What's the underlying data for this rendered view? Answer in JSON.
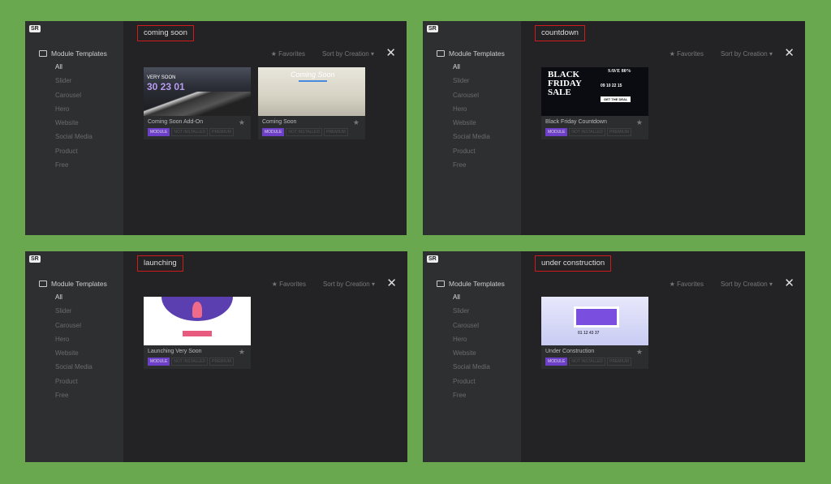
{
  "panels": [
    {
      "search": "coming soon",
      "cards": [
        {
          "title": "Coming Soon Add-On",
          "thumb": "mountain",
          "thumb_text": [
            "VERY SOON",
            "30 23 01"
          ]
        },
        {
          "title": "Coming Soon",
          "thumb": "horse",
          "thumb_text": [
            "Coming Soon"
          ]
        }
      ]
    },
    {
      "search": "countdown",
      "cards": [
        {
          "title": "Black Friday Countdown",
          "thumb": "blackfriday",
          "thumb_text": [
            "BLACK FRIDAY SALE",
            "SAVE 80%",
            "09 10 22 15",
            "GET THE DEAL"
          ]
        }
      ]
    },
    {
      "search": "launching",
      "cards": [
        {
          "title": "Launching Very Soon",
          "thumb": "rocket",
          "thumb_text": []
        }
      ]
    },
    {
      "search": "under construction",
      "cards": [
        {
          "title": "Under Construction",
          "thumb": "construction",
          "thumb_text": [
            "01 12 43 37"
          ]
        }
      ]
    }
  ],
  "common": {
    "logo": "SR",
    "section_title": "Module Templates",
    "categories": [
      "All",
      "Slider",
      "Carousel",
      "Hero",
      "Website",
      "Social Media",
      "Product",
      "Free"
    ],
    "favorites": "Favorites",
    "sort": "Sort by Creation",
    "close": "✕",
    "tags": [
      "MODULE",
      "NOT INSTALLED",
      "PREMIUM"
    ]
  },
  "colors": {
    "accent": "#6e3fc9",
    "highlight_box": "#d0191a",
    "background": "#6aa84f"
  }
}
